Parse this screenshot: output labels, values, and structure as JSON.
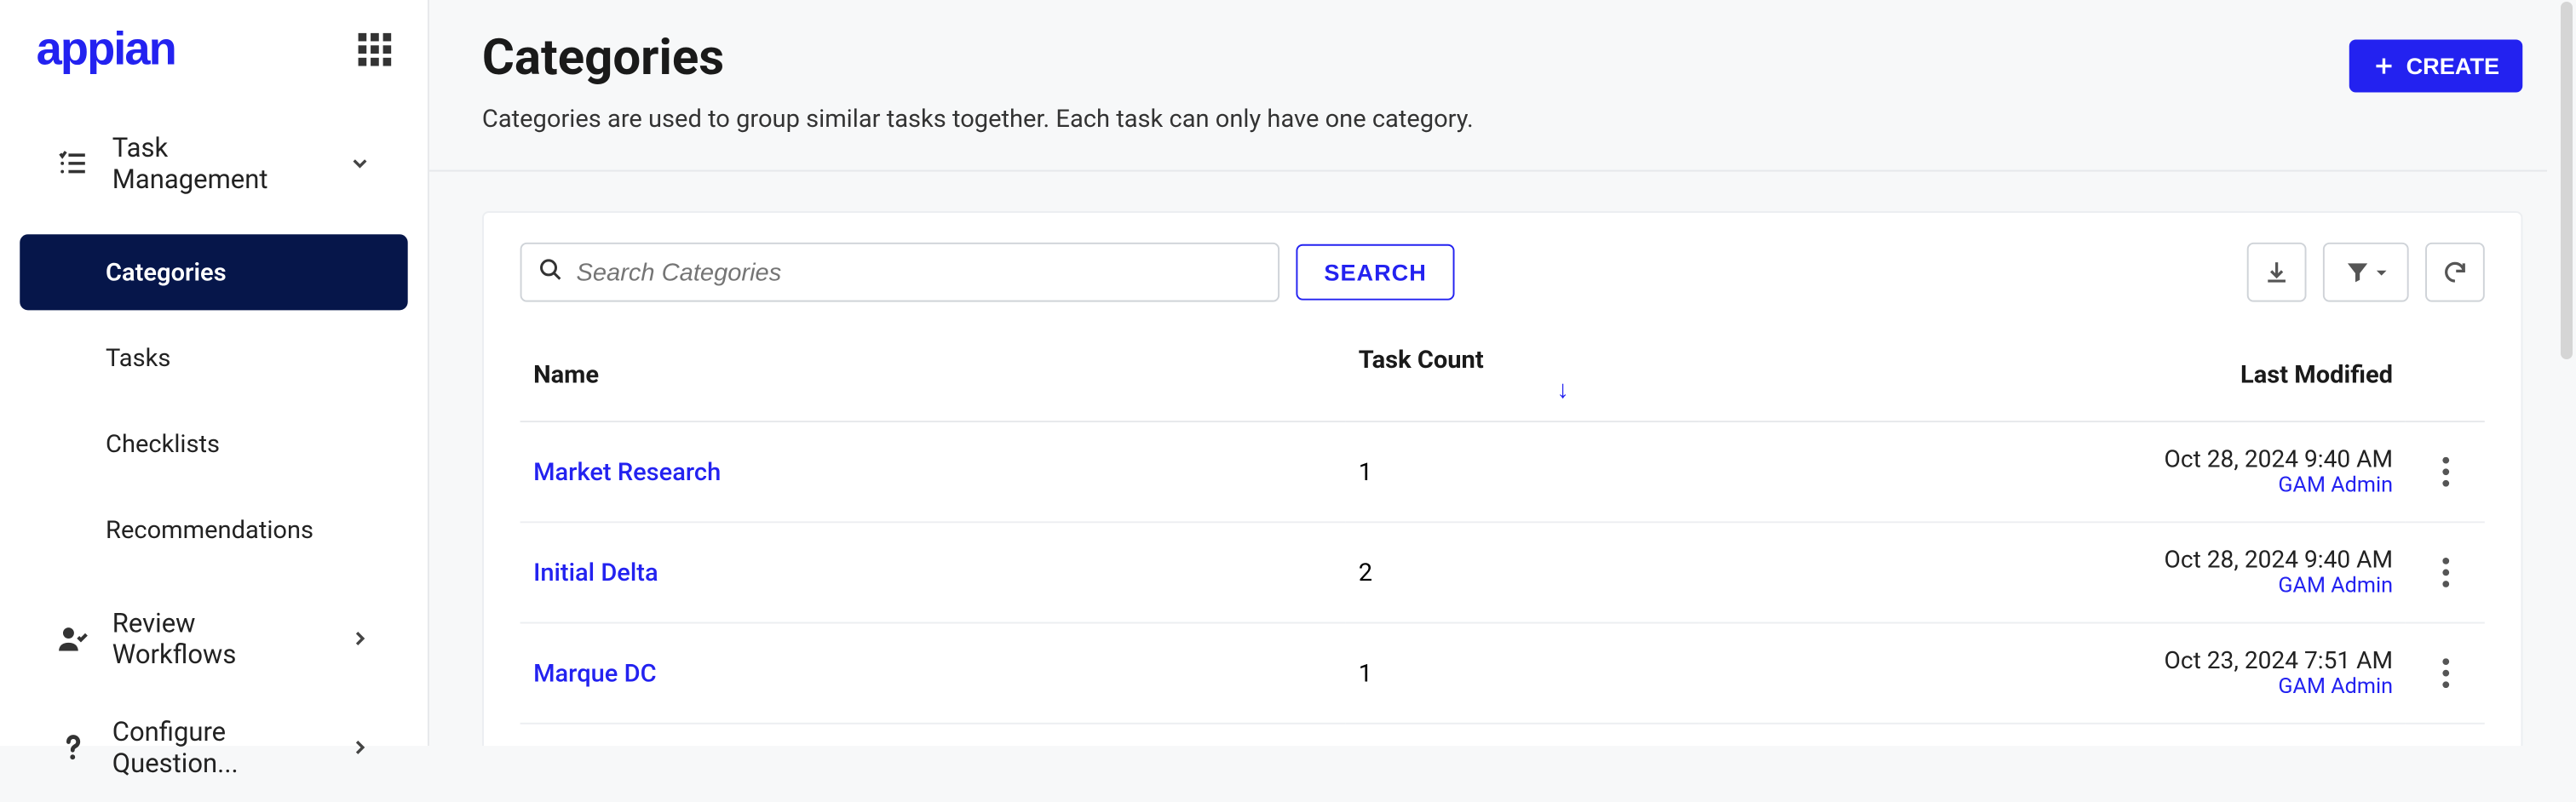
{
  "logo": "appian",
  "sidebar": {
    "groups": [
      {
        "icon": "list-check-icon",
        "label": "Task Management",
        "expanded": true,
        "chev": "down",
        "items": [
          {
            "label": "Categories",
            "active": true
          },
          {
            "label": "Tasks",
            "active": false
          },
          {
            "label": "Checklists",
            "active": false
          },
          {
            "label": "Recommendations",
            "active": false
          }
        ]
      },
      {
        "icon": "user-check-icon",
        "label": "Review Workflows",
        "expanded": false,
        "chev": "right",
        "items": []
      },
      {
        "icon": "question-icon",
        "label": "Configure Question...",
        "expanded": false,
        "chev": "right",
        "items": []
      }
    ]
  },
  "page": {
    "title": "Categories",
    "description": "Categories are used to group similar tasks together. Each task can only have one category.",
    "create_label": "CREATE"
  },
  "toolbar": {
    "search_placeholder": "Search Categories",
    "search_button": "SEARCH"
  },
  "table": {
    "columns": {
      "name": "Name",
      "task_count": "Task Count",
      "last_modified": "Last Modified"
    },
    "sort_indicator": "↓",
    "rows": [
      {
        "name": "Market Research",
        "task_count": "1",
        "modified": "Oct 28, 2024 9:40 AM",
        "by": "GAM Admin"
      },
      {
        "name": "Initial Delta",
        "task_count": "2",
        "modified": "Oct 28, 2024 9:40 AM",
        "by": "GAM Admin"
      },
      {
        "name": "Marque DC",
        "task_count": "1",
        "modified": "Oct 23, 2024 7:51 AM",
        "by": "GAM Admin"
      }
    ]
  }
}
